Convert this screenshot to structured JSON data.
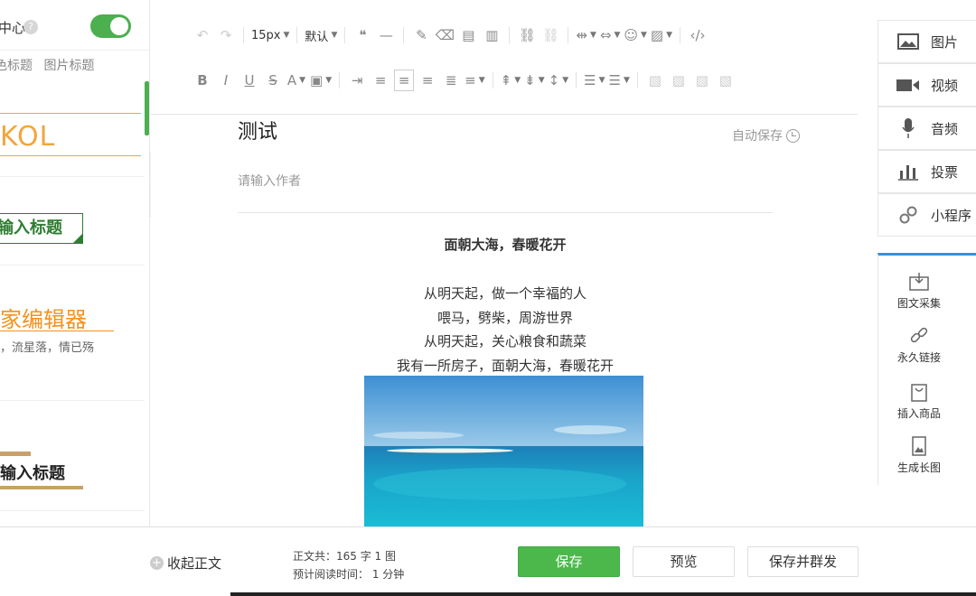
{
  "left_panel": {
    "center_label": "中心",
    "help": "?",
    "tabs": [
      "色标题",
      "图片标题"
    ],
    "templates": {
      "kol": "KOL",
      "green_title": "输入标题",
      "orange_title": "家编辑器",
      "orange_sub": "，流星落，情已殇",
      "bar_title": "输入标题"
    }
  },
  "toolbar": {
    "font_size": "15px",
    "font_family": "默认"
  },
  "article": {
    "title": "测试",
    "autosave": "自动保存",
    "author_placeholder": "请输入作者",
    "heading": "面朝大海，春暖花开",
    "lines": [
      "从明天起，做一个幸福的人",
      "喂马，劈柴，周游世界",
      "从明天起，关心粮食和蔬菜",
      "我有一所房子，面朝大海，春暖花开"
    ]
  },
  "right_panel": {
    "buttons": [
      "图片",
      "视频",
      "音频",
      "投票",
      "小程序"
    ],
    "tools": [
      "图文采集",
      "永久链接",
      "插入商品",
      "生成长图"
    ]
  },
  "footer": {
    "collapse_body": "收起正文",
    "stats_line1": "正文共：165 字 1 图",
    "stats_line2": "预计阅读时间： 1 分钟",
    "save": "保存",
    "preview": "预览",
    "save_mass": "保存并群发"
  },
  "colors": {
    "primary_green": "#4cb84c",
    "accent_blue": "#3b8fd9",
    "orange": "#f4a43c"
  }
}
